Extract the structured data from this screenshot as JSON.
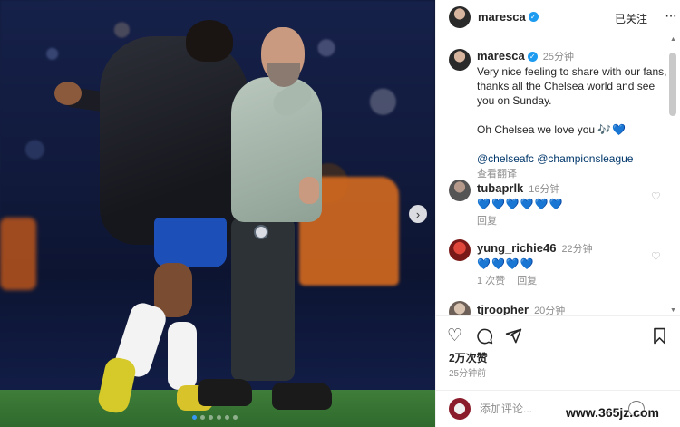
{
  "header": {
    "username": "maresca",
    "follow_status": "已关注",
    "more_icon": "more-options-icon"
  },
  "caption": {
    "username": "maresca",
    "time": "25分钟",
    "text": "Very nice feeling to share with our fans, thanks all the Chelsea world and see you on Sunday.",
    "text2": "Oh Chelsea we love you",
    "emoji": "🎶💙",
    "tag1": "@chelseafc",
    "tag2": "@championsleague",
    "translate": "查看翻译"
  },
  "comments": [
    {
      "username": "tubaprlk",
      "time": "16分钟",
      "text": "💙💙💙💙💙💙",
      "reply": "回复",
      "likes": ""
    },
    {
      "username": "yung_richie46",
      "time": "22分钟",
      "text": "💙💙💙💙",
      "likes": "1 次赞",
      "reply": "回复"
    },
    {
      "username": "tjroopher",
      "time": "20分钟",
      "text": ""
    }
  ],
  "actions": {
    "like_icon": "heart-icon",
    "comment_icon": "comment-icon",
    "share_icon": "share-icon",
    "save_icon": "bookmark-icon"
  },
  "likes_count": "2万次赞",
  "post_time": "25分钟前",
  "comment_input": {
    "placeholder": "添加评论..."
  },
  "carousel": {
    "total_slides": 6,
    "active_slide": 1
  },
  "watermark": "www.365jz.com",
  "colors": {
    "accent": "#3897f0",
    "verified": "#1d9bf0",
    "heart": "#1d6fe0",
    "tag": "#00376b"
  }
}
